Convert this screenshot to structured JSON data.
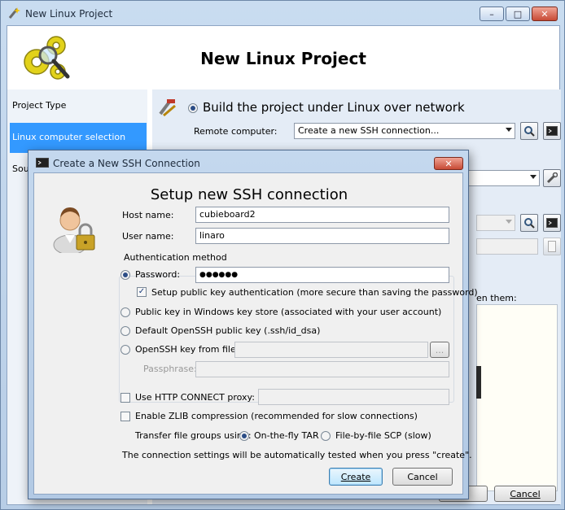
{
  "main_window": {
    "title": "New Linux Project",
    "header_title": "New Linux Project",
    "controls": {
      "minimize": "–",
      "maximize": "□",
      "close": "✕"
    }
  },
  "sidebar": {
    "items": [
      {
        "label": "Project Type"
      },
      {
        "label": "Linux computer selection"
      },
      {
        "label": "Sour"
      }
    ]
  },
  "content": {
    "build_network_option": "Build the project under Linux over network",
    "remote_computer_label": "Remote computer:",
    "remote_computer_value": "Create a new SSH connection...",
    "partial_label": "en them:",
    "cancel_label": "Cancel"
  },
  "dialog": {
    "title": "Create a New SSH Connection",
    "heading": "Setup new SSH connection",
    "host_label": "Host name:",
    "host_value": "cubieboard2",
    "user_label": "User name:",
    "user_value": "linaro",
    "auth_group_label": "Authentication method",
    "password_option": "Password:",
    "password_value": "●●●●●●",
    "setup_pubkey_option": "Setup public key authentication (more secure than saving the password)",
    "windows_key_option": "Public key in Windows key store (associated with your user account)",
    "default_key_option": "Default OpenSSH public key (.ssh/id_dsa)",
    "key_file_option": "OpenSSH key from file:",
    "browse_label": "...",
    "passphrase_label": "Passphrase:",
    "http_proxy_option": "Use HTTP CONNECT proxy:",
    "zlib_option": "Enable ZLIB compression (recommended for slow connections)",
    "transfer_label": "Transfer file groups using:",
    "tar_option": "On-the-fly TAR",
    "scp_option": "File-by-file SCP (slow)",
    "note": "The connection settings will be automatically tested when you press \"create\".",
    "create_label": "Create",
    "cancel_label": "Cancel"
  },
  "colors": {
    "selection": "#3399ff",
    "dialog_frame": "#b2c9e4"
  }
}
